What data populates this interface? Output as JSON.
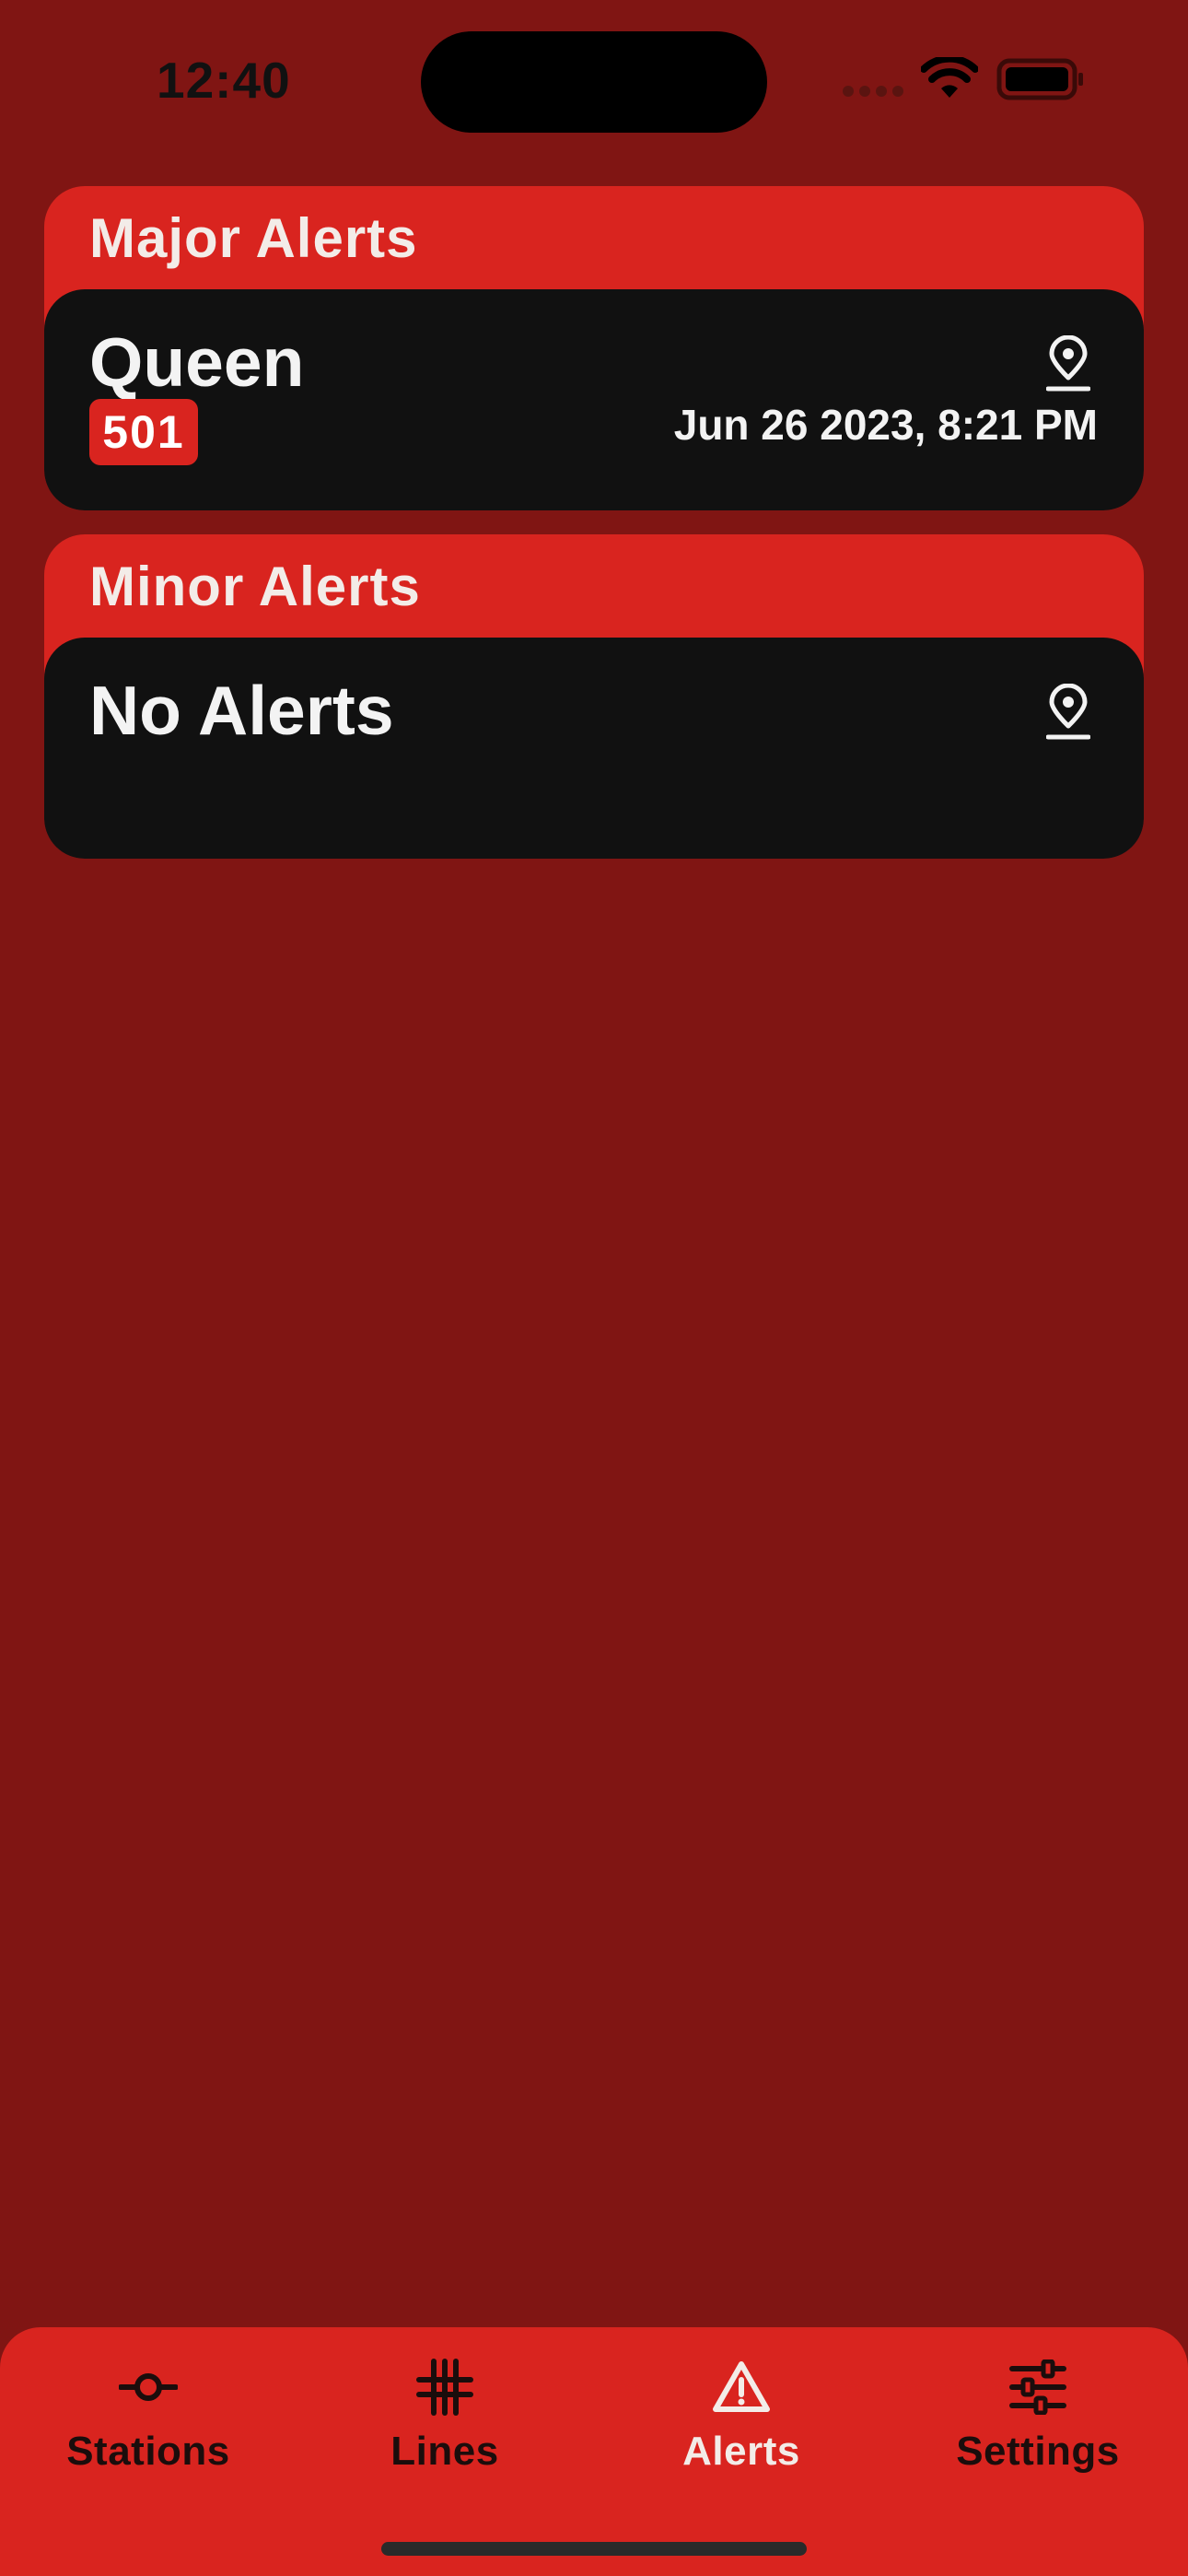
{
  "status_bar": {
    "time": "12:40"
  },
  "sections": [
    {
      "title": "Major Alerts",
      "alert": {
        "title": "Queen",
        "line": "501",
        "date": "Jun 26 2023, 8:21 PM"
      }
    },
    {
      "title": "Minor Alerts",
      "alert": {
        "title": "No Alerts"
      }
    }
  ],
  "tabs": [
    {
      "label": "Stations",
      "icon": "station-icon"
    },
    {
      "label": "Lines",
      "icon": "lines-icon"
    },
    {
      "label": "Alerts",
      "icon": "alert-icon",
      "active": true
    },
    {
      "label": "Settings",
      "icon": "sliders-icon"
    }
  ],
  "colors": {
    "background": "#801513",
    "accent": "#d9241f",
    "card": "#111111"
  }
}
